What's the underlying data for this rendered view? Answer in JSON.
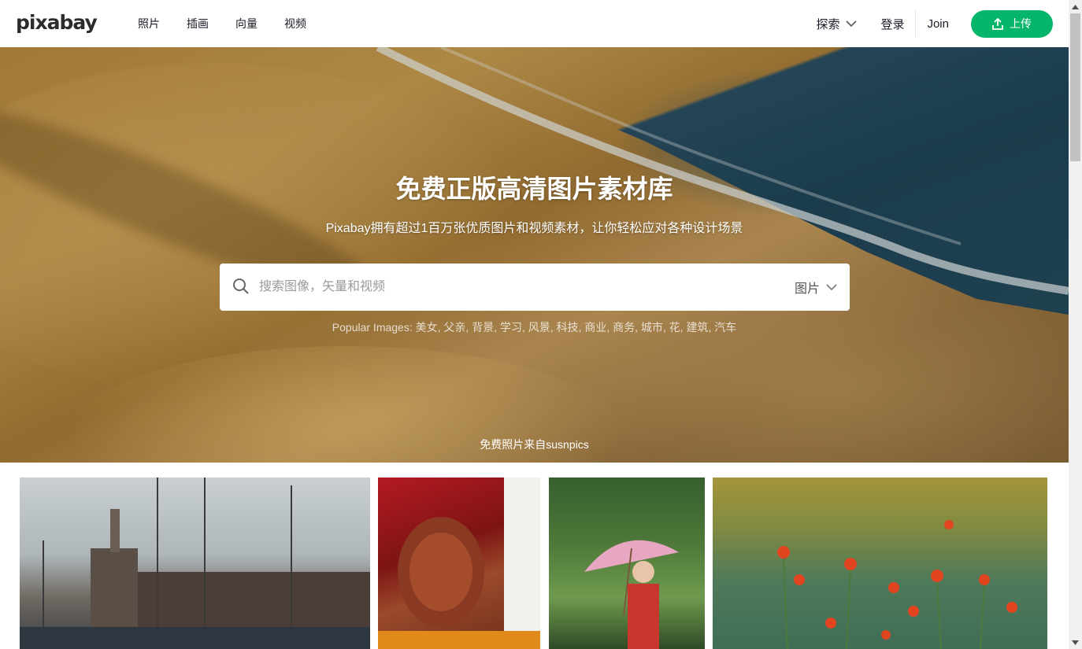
{
  "header": {
    "logo": "pixabay",
    "nav": [
      "照片",
      "插画",
      "向量",
      "视频"
    ],
    "explore_label": "探索",
    "login_label": "登录",
    "join_label": "Join",
    "upload_label": "上传"
  },
  "hero": {
    "title": "免费正版高清图片素材库",
    "subtitle": "Pixabay拥有超过1百万张优质图片和视频素材，让你轻松应对各种设计场景",
    "search_placeholder": "搜索图像，矢量和视频",
    "search_type": "图片",
    "popular_label": "Popular Images:",
    "popular_tags": [
      "美女",
      "父亲",
      "背景",
      "学习",
      "风景",
      "科技",
      "商业",
      "商务",
      "城市",
      "花",
      "建筑",
      "汽车"
    ],
    "credit": "免费照片来自susnpics"
  },
  "colors": {
    "accent": "#05b56a"
  }
}
